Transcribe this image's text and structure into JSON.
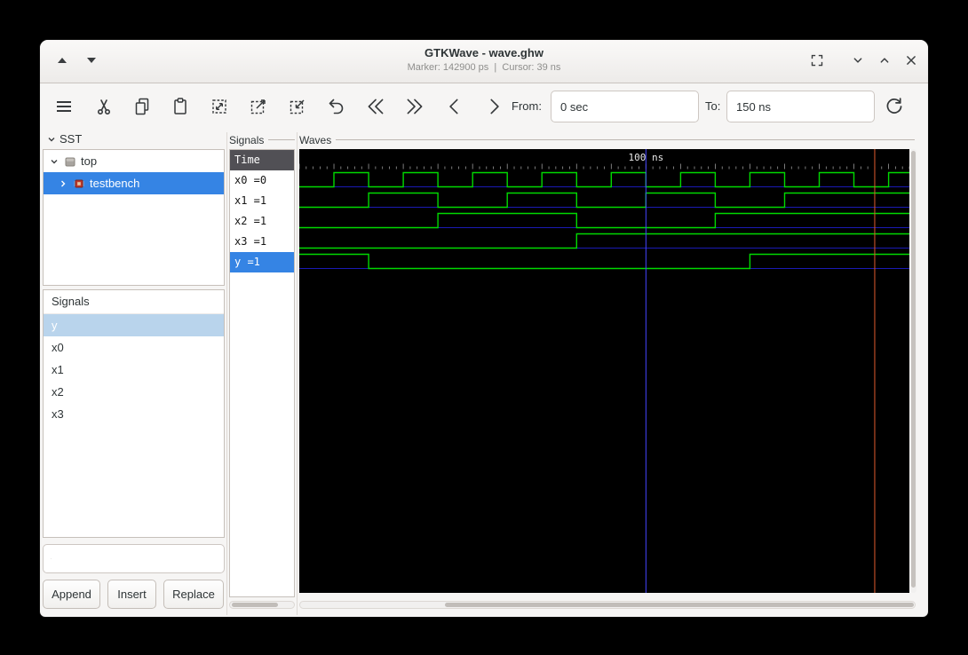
{
  "window": {
    "title": "GTKWave - wave.ghw",
    "subtitle": "Marker: 142900 ps  |  Cursor: 39 ns",
    "left_controls": [
      "arrow-up",
      "arrow-down"
    ],
    "right_controls": [
      "restore",
      "chevron-down",
      "chevron-up",
      "close"
    ]
  },
  "toolbar": {
    "icons": [
      "menu",
      "cut",
      "copy",
      "paste",
      "zoom-fit",
      "zoom-in",
      "zoom-out",
      "undo",
      "skip-to-start",
      "skip-to-end",
      "previous",
      "next",
      "reload"
    ],
    "from_label": "From:",
    "from_value": "0 sec",
    "to_label": "To:",
    "to_value": "150 ns"
  },
  "sst": {
    "header": "SST",
    "items": [
      {
        "label": "top",
        "expanded": true,
        "selected": false
      },
      {
        "label": "testbench",
        "expanded": false,
        "selected": true
      }
    ]
  },
  "signal_search": {
    "header": "Signals",
    "items": [
      "y",
      "x0",
      "x1",
      "x2",
      "x3"
    ],
    "selected": "y",
    "search_value": "",
    "search_placeholder": "",
    "buttons": {
      "append": "Append",
      "insert": "Insert",
      "replace": "Replace"
    }
  },
  "wave_list": {
    "frame_label": "Signals",
    "time_header": "Time",
    "rows": [
      "x0 =0",
      "x1 =1",
      "x2 =1",
      "x3 =1",
      "y =1"
    ],
    "selected_row": "y =1"
  },
  "waves": {
    "frame_label": "Waves",
    "ruler_label": "100 ns",
    "time_start_ns": 0,
    "time_end_ns": 176,
    "grid_time_ns": 100,
    "marker_time_ns": 166,
    "colors": {
      "background": "#000000",
      "trace": "#00d900",
      "baseline": "#1a1ab4",
      "grid_line": "#4646ff",
      "marker_line": "#e05a2e",
      "ruler_text": "#e8e8e8",
      "tick": "#9a9a9a"
    },
    "signals": [
      {
        "name": "x0",
        "initial": 0,
        "toggles_ns": [
          10,
          20,
          30,
          40,
          50,
          60,
          70,
          80,
          90,
          100,
          110,
          120,
          130,
          140,
          150,
          160,
          170
        ]
      },
      {
        "name": "x1",
        "initial": 0,
        "toggles_ns": [
          20,
          40,
          60,
          80,
          100,
          120,
          140
        ]
      },
      {
        "name": "x2",
        "initial": 0,
        "toggles_ns": [
          40,
          80,
          120
        ]
      },
      {
        "name": "x3",
        "initial": 0,
        "toggles_ns": [
          80
        ]
      },
      {
        "name": "y",
        "initial": 1,
        "toggles_ns": [
          20,
          130
        ]
      }
    ]
  }
}
